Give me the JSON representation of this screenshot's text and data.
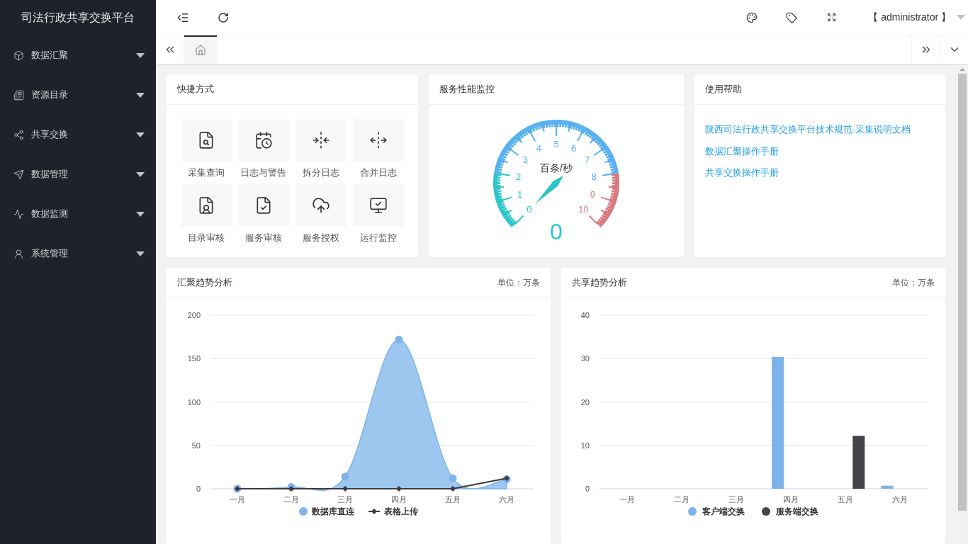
{
  "sidebar": {
    "title": "司法行政共享交换平台",
    "items": [
      {
        "label": "数据汇聚",
        "expanded": false
      },
      {
        "label": "资源目录",
        "expanded": false
      },
      {
        "label": "共享交换",
        "expanded": false
      },
      {
        "label": "数据管理",
        "expanded": false
      },
      {
        "label": "数据监测",
        "expanded": false
      },
      {
        "label": "系统管理",
        "expanded": false
      }
    ]
  },
  "header": {
    "user": "【 administrator 】"
  },
  "tabs": [
    {
      "selected": true
    }
  ],
  "shortcuts": {
    "title": "快捷方式",
    "items": [
      {
        "label": "采集查询"
      },
      {
        "label": "日志与警告"
      },
      {
        "label": "拆分日志"
      },
      {
        "label": "合并日志"
      },
      {
        "label": "目录审核"
      },
      {
        "label": "服务审核"
      },
      {
        "label": "服务授权"
      },
      {
        "label": "运行监控"
      }
    ]
  },
  "monitor": {
    "title": "服务性能监控",
    "gauge": {
      "unit": "百条/秒",
      "value": "0",
      "ticks": [
        "0",
        "1",
        "2",
        "3",
        "4",
        "5",
        "6",
        "7",
        "8",
        "9",
        "10"
      ]
    }
  },
  "help": {
    "title": "使用帮助",
    "links": [
      "陕西司法行政共享交换平台技术规范-采集说明文档",
      "数据汇聚操作手册",
      "共享交换操作手册"
    ]
  },
  "collect_trend": {
    "title": "汇聚趋势分析",
    "unit": "单位：万条",
    "chart_data": {
      "type": "line",
      "categories": [
        "一月",
        "二月",
        "三月",
        "四月",
        "五月",
        "六月"
      ],
      "ylim": [
        0,
        200
      ],
      "yticks": [
        0,
        50,
        100,
        150,
        200
      ],
      "grid": true,
      "series": [
        {
          "name": "数据库直连",
          "type": "area",
          "marker": "circle",
          "color": "#7eb4ea",
          "values": [
            0,
            2,
            14,
            172,
            12,
            11
          ]
        },
        {
          "name": "表格上传",
          "type": "line",
          "marker": "diamond",
          "color": "#3b3b3f",
          "values": [
            0,
            0,
            0,
            0,
            0,
            12
          ]
        }
      ]
    }
  },
  "share_trend": {
    "title": "共享趋势分析",
    "unit": "单位：万条",
    "chart_data": {
      "type": "bar",
      "categories": [
        "一月",
        "二月",
        "三月",
        "四月",
        "五月",
        "六月"
      ],
      "ylim": [
        0,
        40
      ],
      "yticks": [
        0,
        10,
        20,
        30,
        40
      ],
      "grid": true,
      "series": [
        {
          "name": "客户端交换",
          "color": "#7cb3ea",
          "values": [
            0,
            0,
            0,
            30.4,
            0,
            0.7
          ]
        },
        {
          "name": "服务端交换",
          "color": "#434348",
          "values": [
            0,
            0,
            0,
            0,
            12.2,
            0
          ]
        }
      ]
    }
  }
}
